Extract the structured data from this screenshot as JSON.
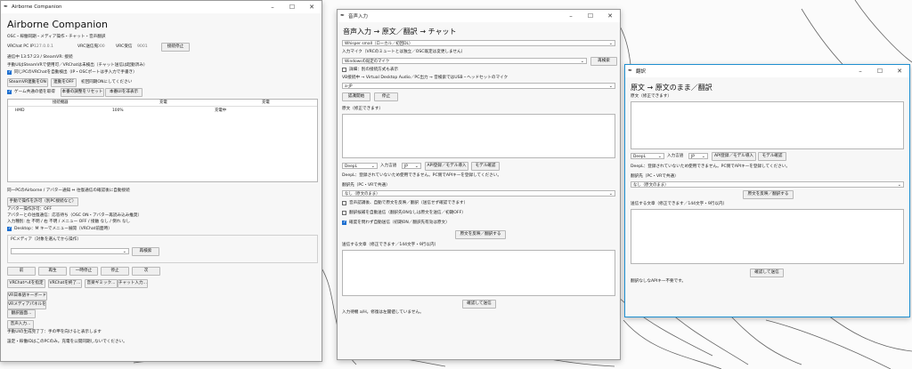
{
  "app_window": {
    "titlebar": "Airborne Companion",
    "title": "Airborne Companion",
    "subtitle": "OSC・稼働同期・メディア操作・チャット・音声翻訳",
    "ip_label": "VRChat PC IP",
    "ip_value": "127.0.0.1",
    "send_port_label": "VRC送信先",
    "send_port_value": "9000",
    "recv_port_label": "VRC受信",
    "recv_port_value": "9001",
    "stop_button": "接続停止",
    "status": "通信中 13:57:23 / SteamVR: 接続",
    "note1": "手動UIはSteamVRで使用可／VRChatは未検出（チャット送信は起動済み）",
    "auto_detect": "同じPCのVRChatを自動検出（IP・OSCポートは手入力で手書き）",
    "steamvr_btn": "SteamVR連動をON",
    "sync_off_btn": "連動をOFF",
    "initial_sync": "初回同期ONにしてください",
    "game_sync": "ゲーム共通の値を取得",
    "reset_btn": "本番の調整をリセット",
    "hide_ui_btn": "本番UIを非表示",
    "table_headers": [
      "接続機器",
      "",
      "充電",
      "充電"
    ],
    "table_row": [
      "HMD",
      "100%",
      "",
      "充電中"
    ],
    "pair_note": "同一PCのAirborne / アバター通知 ⇔ 往復通信の確認後に自動接続",
    "manual_btn": "手動で操作を許可（別PC接続など）",
    "avatar_perm": "アバター操作許可：OFF",
    "avatar_comm": "アバターとの往復通信：応答待ち（OSC ON・アバター再読み込み推奨）",
    "input_method": "入力種別: 左 不明 / 右 不明 / メニュー OFF / 接触 なし / 倒れ なし",
    "desktop_menu": "Desktop：M キーでメニュー展開（VRChat前面時）",
    "pc_media_title": "PCメディア（対象を選んでから操作）",
    "pc_media_placeholder": "",
    "refresh_btn": "再検索",
    "media_buttons": [
      "前",
      "再生",
      "一時停止",
      "停止",
      "次"
    ],
    "action_buttons": [
      "VRChatへ4を指定",
      "VRChatを終了...",
      "音楽ギミック...",
      "チャット入力..."
    ],
    "keyboard_btn": "VR日本語キーボードを開く",
    "media_panel_btn": "VRメディアパネルを開く",
    "translate_btn": "翻訳画面...",
    "voice_btn": "音声入力...",
    "footer1": "手動UIの生成完了了：手の甲を向けると表示します",
    "footer2": "設定・稼働IDはこのPCのみ。充電を公開同期しないでください。"
  },
  "voice_window": {
    "titlebar": "音声入力",
    "title": "音声入力 → 原文／翻訳 → チャット",
    "engine_select": "Whisper small（ローカル／初回DL）",
    "mic_label": "入力マイク（VRCのミュートとは独立／OSC既定は変更しません）",
    "mic_select": "Windowsの既定のマイク",
    "mic_refresh": "再検索",
    "detail_label": "詳細：別の接続方式も表示",
    "vb_label": "VB接続中 → Virtual Desktop Audio／PC出力 → 音検索ではUSB・ヘッドセットのマイク",
    "lang_select": "a-JP",
    "start_btn": "認識開始",
    "stop_btn": "停止",
    "original_label": "原文（修正できます）",
    "trans_engine": "DeepL",
    "target_lang_label": "入力言語",
    "target_lang": "JP",
    "api_btn": "API登録／モデル導入",
    "model_btn": "モデル確認",
    "deepl_note": "DeepL：登録されていないため使用できません。PC側でAPIキーを登録してください。",
    "translate_to_label": "翻訳先（PC・VRで共通）",
    "translate_to": "なし（原文のまま）",
    "cb1": "音声認識後、自動で原文を反映／翻訳（送信せず確認できます）",
    "cb2": "翻訳候補を自動送信（翻訳先ONなしは原文を送信／初期OFF）",
    "cb3": "確度を問わず自動送信（初期ON／翻訳先有効は原文）",
    "reflect_btn": "原文を反映／翻訳する",
    "send_label": "送信する文章（修正できます／144文字・9行以内）",
    "confirm_btn": "確認して送信",
    "footer": "入力待機 a/H。修復は左閾値していません。"
  },
  "translate_window": {
    "titlebar": "翻訳",
    "title": "原文 → 原文のまま／翻訳",
    "original_label": "原文（修正できます）",
    "engine": "DeepL",
    "lang_label": "入力言語",
    "lang": "JP",
    "api_btn": "API登録／モデル導入",
    "model_btn": "モデル確認",
    "deepl_note": "DeepL：登録されていないため使用できません。PC側でAPIキーを登録してください。",
    "translate_to_label": "翻訳先（PC・VRで共通）",
    "translate_to": "なし（原文のまま）",
    "reflect_btn": "原文を反映／翻訳する",
    "send_label": "送信する文章（修正できます／144文字・9行以内）",
    "confirm_btn": "確認して送信",
    "footer": "翻訳なしなAPIキー不要です。"
  },
  "icons": [
    "feather-icon",
    "minimize-icon",
    "maximize-icon",
    "close-icon",
    "chevron-down-icon",
    "checkbox-icon"
  ],
  "colors": {
    "accent": "#1e6fd0",
    "background": "#f7f7f7",
    "border": "#b5b5b5"
  }
}
